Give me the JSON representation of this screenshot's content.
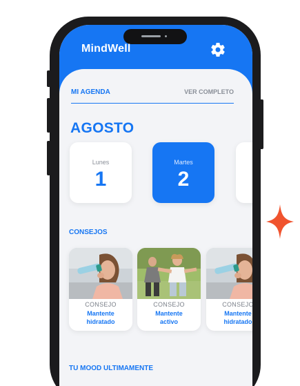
{
  "app": {
    "title": "MindWell"
  },
  "icons": {
    "settings": "gear-icon",
    "accent": "sparkle-icon"
  },
  "colors": {
    "primary": "#1676f3",
    "background": "#f3f4f7",
    "sparkle": "#f0532e"
  },
  "agenda": {
    "title": "MI AGENDA",
    "see_all": "VER COMPLETO",
    "month": "AGOSTO",
    "days": [
      {
        "name": "Lunes",
        "number": "1",
        "selected": false
      },
      {
        "name": "Martes",
        "number": "2",
        "selected": true
      },
      {
        "name": "",
        "number": "",
        "selected": false
      }
    ]
  },
  "tips": {
    "title": "CONSEJOS",
    "items": [
      {
        "kicker": "CONSEJO",
        "title": "Mantente\nhidratado",
        "image": "woman-drinking-water"
      },
      {
        "kicker": "CONSEJO",
        "title": "Mantente\nactivo",
        "image": "people-exercising-outdoors"
      },
      {
        "kicker": "CONSEJO",
        "title": "Mantente\nhidratado",
        "image": "woman-drinking-water"
      }
    ]
  },
  "mood": {
    "title": "TU MOOD ULTIMAMENTE"
  }
}
